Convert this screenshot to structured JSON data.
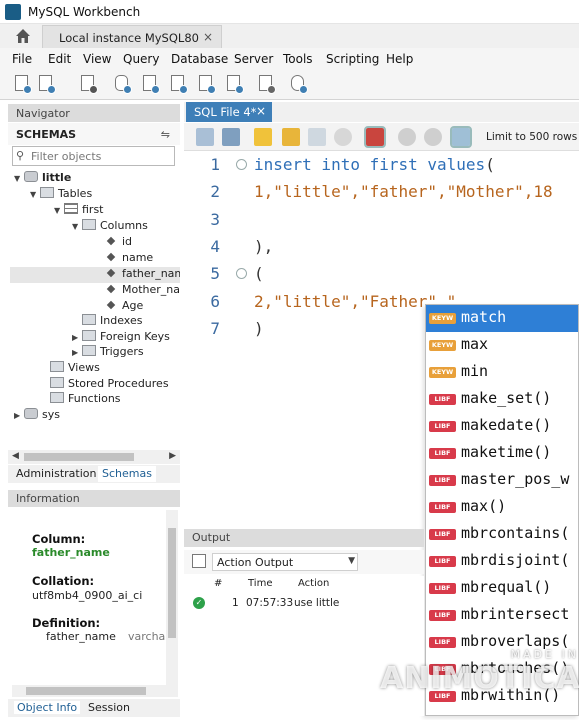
{
  "window": {
    "title": "MySQL Workbench"
  },
  "tabs": {
    "instance_label": "Local instance MySQL80",
    "close": "×"
  },
  "menu": [
    "File",
    "Edit",
    "View",
    "Query",
    "Database",
    "Server",
    "Tools",
    "Scripting",
    "Help"
  ],
  "navigator": {
    "header": "Navigator",
    "schemas_label": "SCHEMAS",
    "filter_placeholder": "Filter objects",
    "tree": [
      {
        "label": "little",
        "bold": true
      },
      {
        "label": "Tables"
      },
      {
        "label": "first"
      },
      {
        "label": "Columns"
      },
      {
        "label": "id"
      },
      {
        "label": "name"
      },
      {
        "label": "father_nam"
      },
      {
        "label": "Mother_nar"
      },
      {
        "label": "Age"
      },
      {
        "label": "Indexes"
      },
      {
        "label": "Foreign Keys"
      },
      {
        "label": "Triggers"
      },
      {
        "label": "Views"
      },
      {
        "label": "Stored Procedures"
      },
      {
        "label": "Functions"
      },
      {
        "label": "sys"
      }
    ],
    "tabs": {
      "administration": "Administration",
      "schemas": "Schemas"
    }
  },
  "information": {
    "header": "Information",
    "column_label": "Column:",
    "column_value": "father_name",
    "collation_label": "Collation:",
    "collation_value": "utf8mb4_0900_ai_ci",
    "definition_label": "Definition:",
    "definition_name": "father_name",
    "definition_type": "varcha",
    "tabs": {
      "object_info": "Object Info",
      "session": "Session"
    }
  },
  "editor": {
    "tab_label": "SQL File 4*",
    "tab_close": "×",
    "limit_label": "Limit to 500 rows",
    "line_numbers": [
      "1",
      "2",
      "3",
      "4",
      "5",
      "6",
      "7"
    ],
    "lines": {
      "l1_kw": "insert into first values",
      "l1_punct": "(",
      "l2": "1,\"little\",\"father\",\"Mother\",18",
      "l4": "),",
      "l5": "(",
      "l6": "2,\"little\",\"Father\",\"",
      "l7": ")"
    }
  },
  "autocomplete": {
    "items": [
      {
        "badge": "KEYW",
        "text": "match",
        "selected": true
      },
      {
        "badge": "KEYW",
        "text": "max"
      },
      {
        "badge": "KEYW",
        "text": "min"
      },
      {
        "badge": "LIBF",
        "text": "make_set()"
      },
      {
        "badge": "LIBF",
        "text": "makedate()"
      },
      {
        "badge": "LIBF",
        "text": "maketime()"
      },
      {
        "badge": "LIBF",
        "text": "master_pos_w"
      },
      {
        "badge": "LIBF",
        "text": "max()"
      },
      {
        "badge": "LIBF",
        "text": "mbrcontains("
      },
      {
        "badge": "LIBF",
        "text": "mbrdisjoint("
      },
      {
        "badge": "LIBF",
        "text": "mbrequal()"
      },
      {
        "badge": "LIBF",
        "text": "mbrintersect"
      },
      {
        "badge": "LIBF",
        "text": "mbroverlaps("
      },
      {
        "badge": "LIBF",
        "text": "mbrtouches()"
      },
      {
        "badge": "LIBF",
        "text": "mbrwithin()"
      }
    ]
  },
  "output": {
    "header": "Output",
    "select_label": "Action Output",
    "columns": {
      "hash": "#",
      "time": "Time",
      "action": "Action"
    },
    "rows": [
      {
        "num": "1",
        "time": "07:57:33",
        "action": "use little"
      }
    ]
  },
  "watermark": {
    "small": "MADE IN",
    "big": "ANIMOTICA"
  },
  "colors": {
    "accent": "#3e7fb8",
    "selection": "#2e7fd6",
    "keyword": "#2f6fb7",
    "string": "#c17a24"
  }
}
